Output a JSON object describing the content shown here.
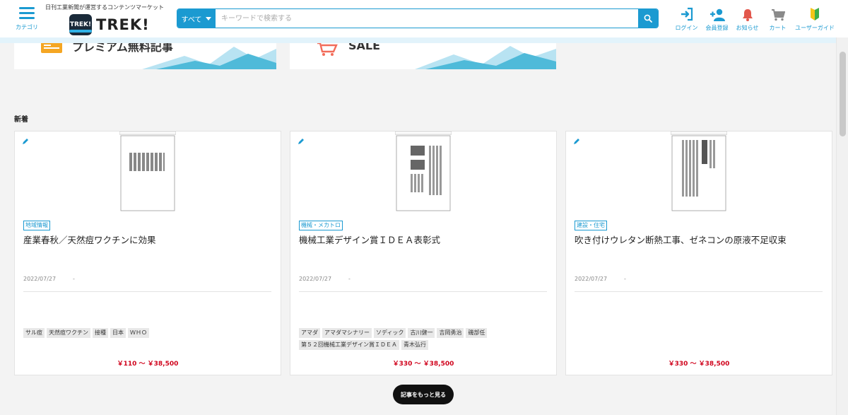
{
  "header": {
    "menu_label": "カテゴリ",
    "tagline": "日刊工業新聞が運営するコンテンツマーケット",
    "logo_badge": "TREK!",
    "logo_text": "TREK!",
    "search": {
      "category": "すべて",
      "placeholder": "キーワードで検索する"
    },
    "nav": [
      {
        "label": "ログイン",
        "icon": "login-icon"
      },
      {
        "label": "会員登録",
        "icon": "add-user-icon"
      },
      {
        "label": "お知らせ",
        "icon": "bell-icon"
      },
      {
        "label": "カート",
        "icon": "cart-icon"
      },
      {
        "label": "ユーザーガイド",
        "icon": "beginner-mark-icon"
      }
    ]
  },
  "banners": [
    {
      "title": "プレミアム無料記事",
      "icon": "newspaper-icon"
    },
    {
      "title": "SALE",
      "icon": "cart-icon"
    }
  ],
  "section_title": "新着",
  "cards": [
    {
      "tag": "地域情報",
      "headline": "産業春秋／天然痘ワクチンに効果",
      "date": "2022/07/27",
      "dash": "-",
      "keywords": [
        "サル痘",
        "天然痘ワクチン",
        "接種",
        "日本",
        "ＷＨＯ"
      ],
      "price": "￥110 〜 ￥38,500"
    },
    {
      "tag": "機械・メカトロ",
      "headline": "機械工業デザイン賞ＩＤＥＡ表彰式",
      "date": "2022/07/27",
      "dash": "-",
      "keywords": [
        "アマダ",
        "アマダマシナリー",
        "ソディック",
        "古川健一",
        "吉岡勇治",
        "磯部任",
        "第５２回機械工業デザイン賞ＩＤＥＡ",
        "青木弘行"
      ],
      "price": "￥330 〜 ￥38,500"
    },
    {
      "tag": "建設・住宅",
      "headline": "吹き付けウレタン断熱工事、ゼネコンの原液不足収束",
      "date": "2022/07/27",
      "dash": "-",
      "keywords": [],
      "price": "￥330 〜 ￥38,500"
    }
  ],
  "more_button": "記事をもっと見る",
  "colors": {
    "accent": "#1b9ad1",
    "price": "#d0021b",
    "bell": "#e2574c",
    "button": "#111111"
  }
}
